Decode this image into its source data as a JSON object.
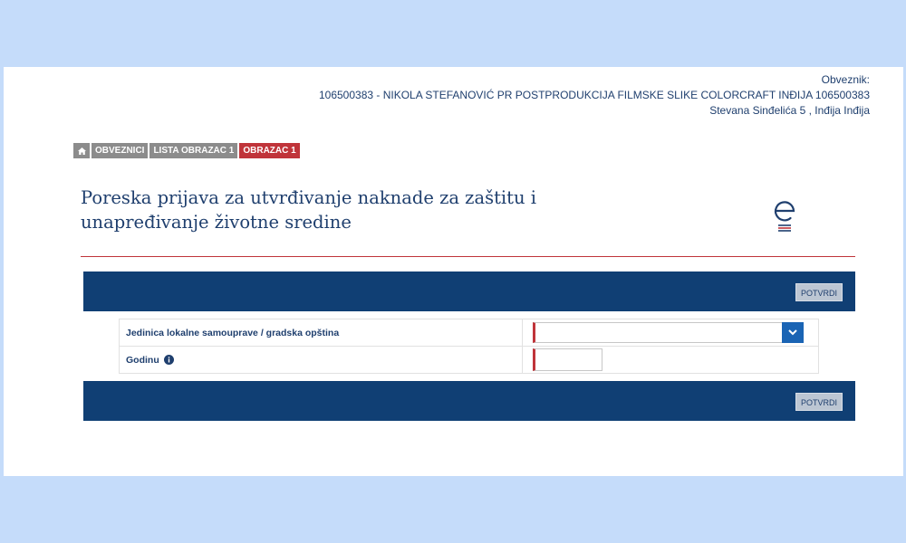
{
  "header": {
    "taxpayer_label": "Obveznik:",
    "taxpayer_name": "106500383 - NIKOLA STEFANOVIĆ PR POSTPRODUKCIJA FILMSKE SLIKE COLORCRAFT INĐIJA 106500383",
    "taxpayer_address": "Stevana Sinđelića 5 , Inđija Inđija"
  },
  "breadcrumb": {
    "home_icon": "home-icon",
    "items": [
      "OBVEZNICI",
      "LISTA OBRAZAC 1",
      "OBRAZAC 1"
    ]
  },
  "page": {
    "title": "Poreska prijava za utvrđivanje naknade za zaštitu i unapređivanje životne sredine",
    "logo_icon": "e-logo-icon"
  },
  "actions": {
    "confirm_label": "POTVRDI"
  },
  "form": {
    "municipality_label": "Jedinica lokalne samouprave / gradska opština",
    "municipality_value": "",
    "year_label": "Godinu",
    "year_value": ""
  },
  "colors": {
    "background": "#c5dcfa",
    "navy": "#103f74",
    "accent_red": "#c0343a",
    "text_blue": "#1f3f6e",
    "select_button": "#1a64b4"
  }
}
